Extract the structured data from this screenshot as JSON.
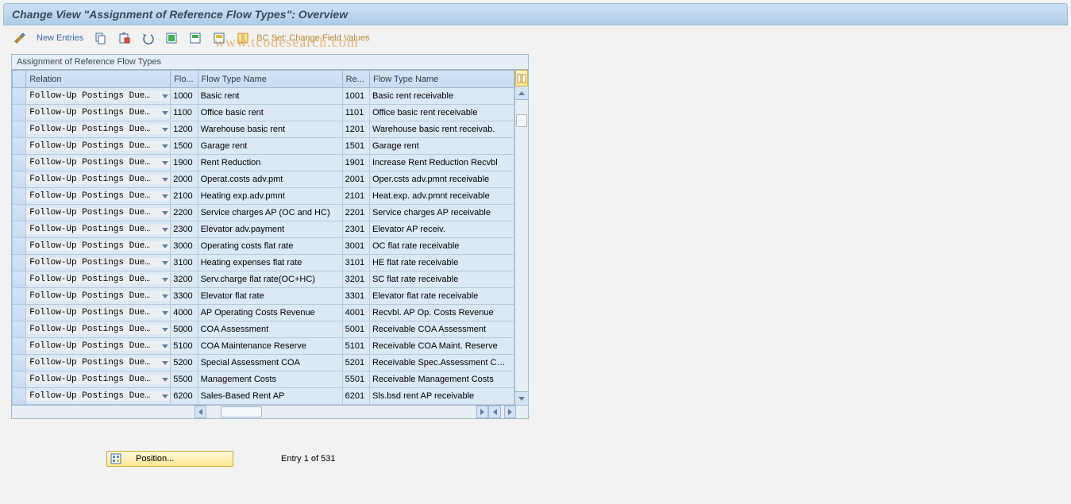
{
  "title": "Change View \"Assignment of Reference Flow Types\": Overview",
  "toolbar": {
    "new_entries": "New Entries",
    "bc_set": "BC Set: Change Field Values"
  },
  "watermark": "www.tcodesearch.com",
  "panel": {
    "title": "Assignment of Reference Flow Types",
    "columns": {
      "relation": "Relation",
      "flow1": "Flo...",
      "name1": "Flow Type Name",
      "ref": "Re...",
      "name2": "Flow Type Name"
    }
  },
  "relation_label": "Follow-Up Postings Due…",
  "rows": [
    {
      "flow": "1000",
      "name1": "Basic rent",
      "ref": "1001",
      "name2": "Basic rent receivable"
    },
    {
      "flow": "1100",
      "name1": "Office basic rent",
      "ref": "1101",
      "name2": "Office basic rent receivable"
    },
    {
      "flow": "1200",
      "name1": "Warehouse basic rent",
      "ref": "1201",
      "name2": "Warehouse basic rent receivab."
    },
    {
      "flow": "1500",
      "name1": "Garage rent",
      "ref": "1501",
      "name2": "Garage rent"
    },
    {
      "flow": "1900",
      "name1": "Rent Reduction",
      "ref": "1901",
      "name2": "Increase Rent Reduction Recvbl"
    },
    {
      "flow": "2000",
      "name1": "Operat.costs adv.pmt",
      "ref": "2001",
      "name2": "Oper.csts adv.pmnt receivable"
    },
    {
      "flow": "2100",
      "name1": "Heating exp.adv.pmnt",
      "ref": "2101",
      "name2": "Heat.exp. adv.pmnt receivable"
    },
    {
      "flow": "2200",
      "name1": "Service charges AP (OC and HC)",
      "ref": "2201",
      "name2": "Service charges AP receivable"
    },
    {
      "flow": "2300",
      "name1": "Elevator adv.payment",
      "ref": "2301",
      "name2": "Elevator AP receiv."
    },
    {
      "flow": "3000",
      "name1": "Operating costs flat rate",
      "ref": "3001",
      "name2": "OC flat rate receivable"
    },
    {
      "flow": "3100",
      "name1": "Heating expenses flat rate",
      "ref": "3101",
      "name2": "HE flat rate receivable"
    },
    {
      "flow": "3200",
      "name1": "Serv.charge flat rate(OC+HC)",
      "ref": "3201",
      "name2": "SC flat rate receivable"
    },
    {
      "flow": "3300",
      "name1": "Elevator flat rate",
      "ref": "3301",
      "name2": "Elevator flat rate receivable"
    },
    {
      "flow": "4000",
      "name1": "AP Operating Costs Revenue",
      "ref": "4001",
      "name2": "Recvbl. AP Op. Costs Revenue"
    },
    {
      "flow": "5000",
      "name1": "COA Assessment",
      "ref": "5001",
      "name2": "Receivable COA Assessment"
    },
    {
      "flow": "5100",
      "name1": "COA Maintenance Reserve",
      "ref": "5101",
      "name2": "Receivable COA Maint. Reserve"
    },
    {
      "flow": "5200",
      "name1": "Special Assessment COA",
      "ref": "5201",
      "name2": "Receivable Spec.Assessment C…"
    },
    {
      "flow": "5500",
      "name1": "Management Costs",
      "ref": "5501",
      "name2": "Receivable Management Costs"
    },
    {
      "flow": "6200",
      "name1": "Sales-Based Rent AP",
      "ref": "6201",
      "name2": "Sls.bsd rent AP receivable"
    }
  ],
  "footer": {
    "position": "Position...",
    "entry": "Entry 1 of 531"
  }
}
